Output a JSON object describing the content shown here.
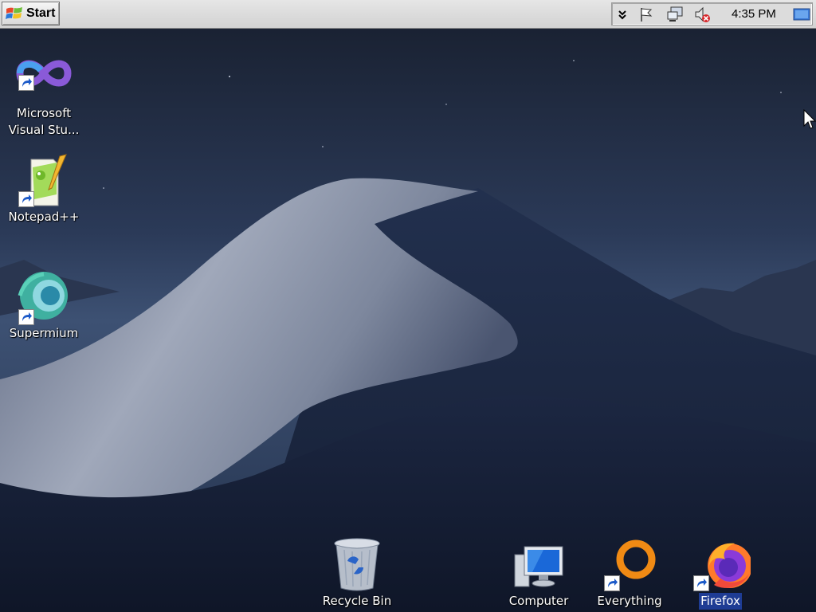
{
  "taskbar": {
    "start_label": "Start",
    "tray": {
      "icons": [
        "chevron-double-down-icon",
        "action-center-flag-icon",
        "network-icon",
        "volume-muted-icon",
        "show-desktop-icon"
      ],
      "clock": "4:35 PM"
    }
  },
  "desktop": {
    "icons": [
      {
        "label_line1": "Microsoft",
        "label_line2": "Visual Stu...",
        "icon": "visual-studio-icon",
        "shortcut": true
      },
      {
        "label": "Notepad++",
        "icon": "notepad-plus-plus-icon",
        "shortcut": true
      },
      {
        "label": "Supermium",
        "icon": "supermium-icon",
        "shortcut": true
      },
      {
        "label": "Recycle Bin",
        "icon": "recycle-bin-icon",
        "shortcut": false
      },
      {
        "label": "Computer",
        "icon": "computer-icon",
        "shortcut": false
      },
      {
        "label": "Everything",
        "icon": "everything-search-icon",
        "shortcut": true
      },
      {
        "label": "Firefox",
        "icon": "firefox-icon",
        "shortcut": true,
        "selected": true
      }
    ]
  },
  "colors": {
    "sky_top": "#1a2233",
    "sky_mid": "#34476a",
    "dune_light": "#8a93a8",
    "dune_dark": "#1c2740",
    "selection": "#1e3c94"
  }
}
